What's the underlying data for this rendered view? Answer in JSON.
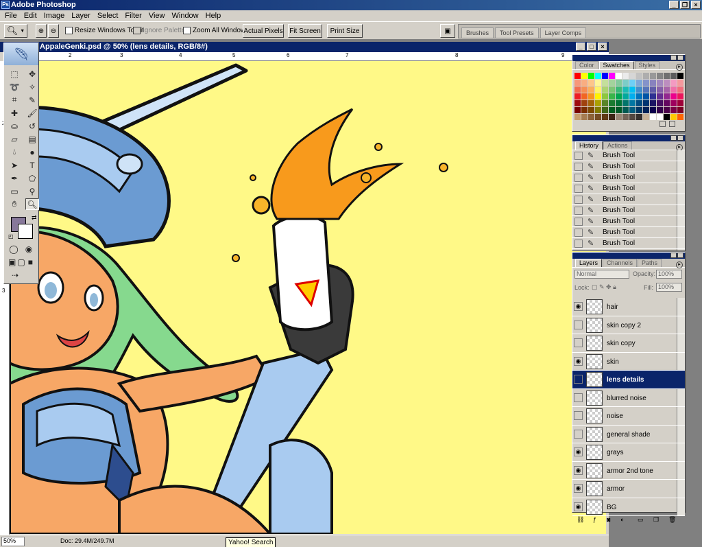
{
  "app": {
    "title": "Adobe Photoshop"
  },
  "menu": [
    "File",
    "Edit",
    "Image",
    "Layer",
    "Select",
    "Filter",
    "View",
    "Window",
    "Help"
  ],
  "options": {
    "resize_windows": "Resize Windows To Fit",
    "ignore_palettes": "Ignore Palettes",
    "zoom_all": "Zoom All Windows",
    "actual_pixels": "Actual Pixels",
    "fit_screen": "Fit Screen",
    "print_size": "Print Size"
  },
  "palette_well": [
    "Brushes",
    "Tool Presets",
    "Layer Comps"
  ],
  "document": {
    "title": "AppaleGenki.psd @ 50% (lens details, RGB/8#)",
    "ruler_top": [
      "2",
      "3",
      "4",
      "5",
      "6",
      "7",
      "8",
      "9"
    ],
    "ruler_left": [
      "2",
      "3"
    ]
  },
  "status": {
    "zoom": "50%",
    "doc_info": "Doc: 29.4M/249.7M",
    "tooltip": "Yahoo! Search"
  },
  "color_palette": {
    "tabs": [
      "Color",
      "Swatches",
      "Styles"
    ],
    "active_tab": "Swatches",
    "swatches": [
      "#ff0000",
      "#ffff00",
      "#00ff00",
      "#00ffff",
      "#0000ff",
      "#ff00ff",
      "#ffffff",
      "#ebebeb",
      "#d6d6d6",
      "#c2c2c2",
      "#adadad",
      "#999999",
      "#858585",
      "#707070",
      "#5c5c5c",
      "#000000",
      "#f7977a",
      "#f9ad81",
      "#fdc68a",
      "#fff79a",
      "#c4df9b",
      "#a2d39c",
      "#82ca9d",
      "#7bcdc8",
      "#6ecff6",
      "#7ea7d8",
      "#8493ca",
      "#8882be",
      "#a187be",
      "#bc8dbf",
      "#f49ac2",
      "#f6989d",
      "#f26c4f",
      "#f68e55",
      "#fbaf5c",
      "#fff467",
      "#acd372",
      "#7cc576",
      "#3bb878",
      "#1abbb4",
      "#00bff3",
      "#438cca",
      "#5574b9",
      "#605ca8",
      "#855fa8",
      "#a763a8",
      "#f06ea9",
      "#f26d7d",
      "#ed1c24",
      "#f26522",
      "#f7941d",
      "#fff200",
      "#8dc73f",
      "#39b54a",
      "#00a651",
      "#00a99d",
      "#00aeef",
      "#0072bc",
      "#0054a6",
      "#2e3192",
      "#662d91",
      "#92278f",
      "#ec008c",
      "#ed145b",
      "#9e0b0f",
      "#a0410d",
      "#a36209",
      "#aba000",
      "#598527",
      "#1a7b30",
      "#007236",
      "#00746b",
      "#0076a3",
      "#004b80",
      "#003471",
      "#1b1464",
      "#440e62",
      "#630460",
      "#9e005d",
      "#9e0039",
      "#790000",
      "#7b2e00",
      "#7d4900",
      "#827b00",
      "#406618",
      "#005e20",
      "#005826",
      "#005952",
      "#005b7f",
      "#003663",
      "#002157",
      "#0d004c",
      "#32004b",
      "#4b0049",
      "#7b0046",
      "#7a0026",
      "#c69c6d",
      "#a67c52",
      "#8c6239",
      "#754c24",
      "#603913",
      "#3c2415",
      "#998675",
      "#736357",
      "#534741",
      "#362f2d",
      "#c7b299",
      "#ffffff",
      "#ffffff",
      "#000000",
      "#ffcc00",
      "#ff6600"
    ]
  },
  "history_palette": {
    "tabs": [
      "History",
      "Actions"
    ],
    "active_tab": "History",
    "items": [
      "Brush Tool",
      "Brush Tool",
      "Brush Tool",
      "Brush Tool",
      "Brush Tool",
      "Brush Tool",
      "Brush Tool",
      "Brush Tool",
      "Brush Tool"
    ]
  },
  "layers_palette": {
    "tabs": [
      "Layers",
      "Channels",
      "Paths"
    ],
    "active_tab": "Layers",
    "blend_mode": "Normal",
    "opacity_label": "Opacity:",
    "opacity": "100%",
    "lock_label": "Lock:",
    "fill_label": "Fill:",
    "fill": "100%",
    "layers": [
      {
        "name": "hair",
        "visible": true,
        "selected": false
      },
      {
        "name": "skin copy 2",
        "visible": false,
        "selected": false
      },
      {
        "name": "skin copy",
        "visible": false,
        "selected": false
      },
      {
        "name": "skin",
        "visible": true,
        "selected": false
      },
      {
        "name": "lens details",
        "visible": false,
        "selected": true
      },
      {
        "name": "blurred noise",
        "visible": false,
        "selected": false
      },
      {
        "name": "noise",
        "visible": false,
        "selected": false
      },
      {
        "name": "general shade",
        "visible": false,
        "selected": false
      },
      {
        "name": "grays",
        "visible": true,
        "selected": false
      },
      {
        "name": "armor 2nd tone",
        "visible": true,
        "selected": false
      },
      {
        "name": "armor",
        "visible": true,
        "selected": false
      },
      {
        "name": "BG",
        "visible": true,
        "selected": false
      }
    ]
  },
  "colors": {
    "foreground": "#87789a",
    "background": "#ffffff",
    "canvas_bg": "#fff987",
    "titlebar": "#0a246a"
  }
}
